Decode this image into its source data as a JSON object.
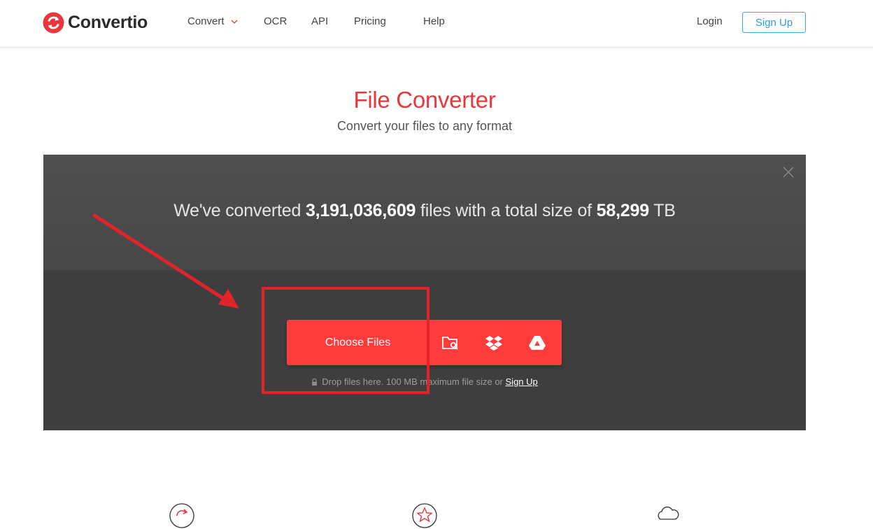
{
  "header": {
    "brand": "Convertio",
    "nav": [
      {
        "label": "Convert",
        "has_dropdown": true
      },
      {
        "label": "OCR"
      },
      {
        "label": "API"
      },
      {
        "label": "Pricing"
      },
      {
        "label": "Help"
      }
    ],
    "login_label": "Login",
    "signup_label": "Sign Up"
  },
  "hero": {
    "title": "File Converter",
    "subtitle": "Convert your files to any format"
  },
  "stats": {
    "prefix": "We've converted",
    "file_count": "3,191,036,609",
    "middle": "files with a total size of",
    "total_size": "58,299",
    "unit": "TB"
  },
  "uploader": {
    "choose_label": "Choose Files",
    "sources": [
      "folder-search-icon",
      "dropbox-icon",
      "google-drive-icon"
    ],
    "note": "Drop files here. 100 MB maximum file size or",
    "note_link": "Sign Up"
  },
  "colors": {
    "brand_red": "#e7393d",
    "button_red": "#ff3b3b",
    "signup_blue": "#2f9fd3",
    "panel_dark": "#3e3e3e",
    "annotation_red": "#e0242a"
  }
}
